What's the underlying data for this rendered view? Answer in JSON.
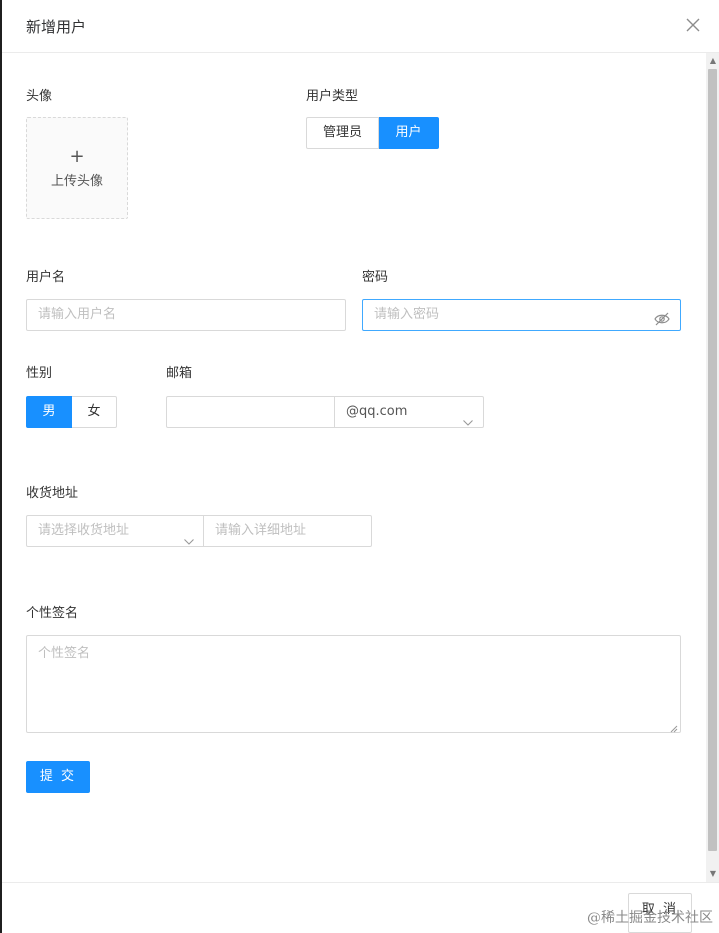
{
  "dialog": {
    "title": "新增用户"
  },
  "avatar": {
    "label": "头像",
    "plus": "+",
    "upload_text": "上传头像"
  },
  "user_type": {
    "label": "用户类型",
    "options": [
      "管理员",
      "用户"
    ],
    "selected": "用户"
  },
  "username": {
    "label": "用户名",
    "placeholder": "请输入用户名"
  },
  "password": {
    "label": "密码",
    "placeholder": "请输入密码"
  },
  "gender": {
    "label": "性别",
    "options": [
      "男",
      "女"
    ],
    "selected": "男"
  },
  "email": {
    "label": "邮箱",
    "value": "",
    "domain": "@qq.com"
  },
  "address": {
    "label": "收货地址",
    "select_placeholder": "请选择收货地址",
    "detail_placeholder": "请输入详细地址"
  },
  "signature": {
    "label": "个性签名",
    "placeholder": "个性签名"
  },
  "actions": {
    "submit": "提 交",
    "cancel": "取 消"
  },
  "watermark": "@稀土掘金技术社区",
  "colors": {
    "primary": "#1890ff",
    "border": "#d9d9d9",
    "focus_border": "#40a9ff",
    "placeholder": "#bfbfbf"
  }
}
